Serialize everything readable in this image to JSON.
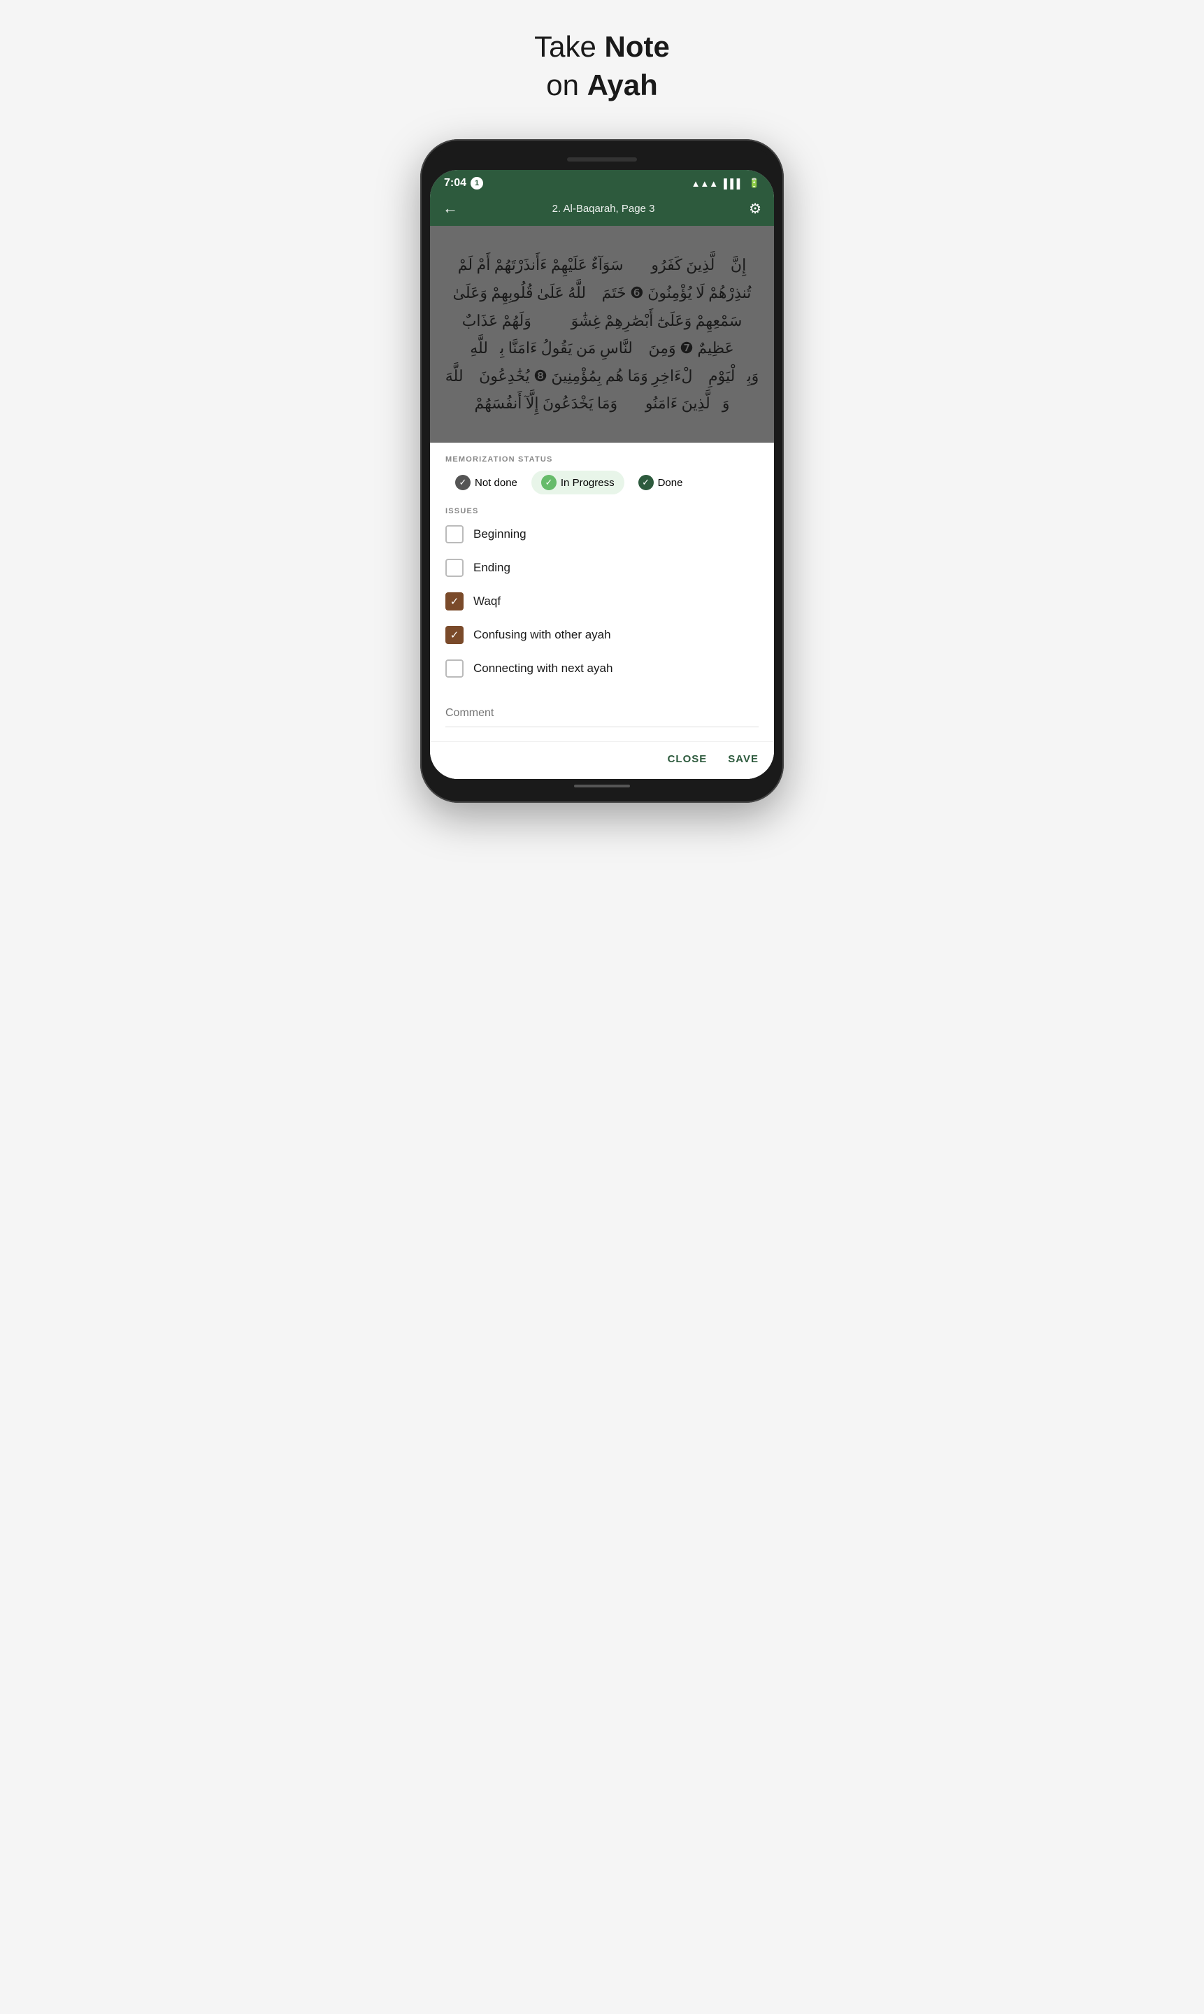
{
  "header": {
    "title_part1": "Take ",
    "title_bold1": "Note",
    "title_part2": "on ",
    "title_bold2": "Ayah"
  },
  "status_bar": {
    "time": "7:04",
    "badge": "1",
    "wifi": "wifi",
    "signal": "signal",
    "battery": "battery"
  },
  "nav": {
    "title": "2. Al-Baqarah, Page 3",
    "back_icon": "←",
    "settings_icon": "⚙"
  },
  "quran": {
    "text": "إِنَّ ٱلَّذِينَ كَفَرُوا۟ سَوَآءٌ عَلَيْهِمْ ءَأَنذَرْتَهُمْ أَمْ لَمْ تُنذِرْهُمْ لَا يُؤْمِنُونَ ❻ خَتَمَ ٱللَّهُ عَلَىٰ قُلُوبِهِمْ وَعَلَىٰ سَمْعِهِمْ وَعَلَىٰٓ أَبْصَٰرِهِمْ غِشَٰوَةٌۢ وَلَهُمْ عَذَابٌ عَظِيمٌ ❼ وَمِنَ ٱلنَّاسِ مَن يَقُولُ ءَامَنَّا بِٱللَّهِ وَبِٱلْيَوْمِ ٱلْءَاخِرِ وَمَا هُم بِمُؤْمِنِينَ ❽ يُخَٰدِعُونَ ٱللَّهَ وَٱلَّذِينَ ءَامَنُوا۟ وَمَا يَخْدَعُونَ إِلَّآ أَنفُسَهُمْ"
  },
  "memorization": {
    "section_label": "MEMORIZATION STATUS",
    "options": [
      {
        "id": "not_done",
        "label": "Not done",
        "active": false
      },
      {
        "id": "in_progress",
        "label": "In Progress",
        "active": true
      },
      {
        "id": "done",
        "label": "Done",
        "active": false
      }
    ]
  },
  "issues": {
    "section_label": "ISSUES",
    "items": [
      {
        "id": "beginning",
        "label": "Beginning",
        "checked": false
      },
      {
        "id": "ending",
        "label": "Ending",
        "checked": false
      },
      {
        "id": "waqf",
        "label": "Waqf",
        "checked": true
      },
      {
        "id": "confusing",
        "label": "Confusing with other ayah",
        "checked": true
      },
      {
        "id": "connecting",
        "label": "Connecting with next ayah",
        "checked": false
      }
    ]
  },
  "comment": {
    "placeholder": "Comment"
  },
  "buttons": {
    "close": "CLOSE",
    "save": "SAVE"
  },
  "colors": {
    "primary_green": "#2d5a3d",
    "light_green": "#66bb6a",
    "checkbox_brown": "#7a4a2a",
    "active_bg": "#e8f5e9"
  }
}
